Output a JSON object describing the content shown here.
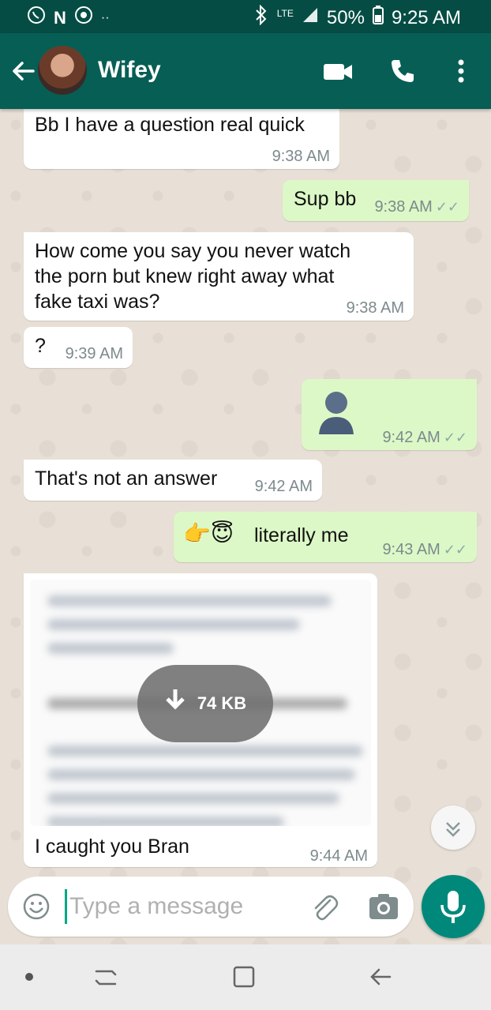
{
  "status_bar": {
    "lte": "LTE",
    "battery": "50%",
    "time": "9:25 AM"
  },
  "header": {
    "contact_name": "Wifey"
  },
  "messages": [
    {
      "text": "Bb I have a question real quick",
      "time": "9:38 AM"
    },
    {
      "text": "Sup bb",
      "time": "9:38 AM"
    },
    {
      "line1": "How come you say you never watch",
      "line2": "the porn but knew right away what",
      "line3": "fake taxi was?",
      "time": "9:38 AM"
    },
    {
      "text": "?",
      "time": "9:39 AM"
    },
    {
      "time": "9:42 AM"
    },
    {
      "text": "That's not an answer",
      "time": "9:42 AM"
    },
    {
      "emoji": "👉😇",
      "text": "literally me",
      "time": "9:43 AM"
    },
    {
      "download_size": "74 KB",
      "caption": "I caught you Bran",
      "time": "9:44 AM"
    }
  ],
  "input": {
    "placeholder": "Type a message"
  },
  "colors": {
    "header": "#075e54",
    "status_bar": "#054d44",
    "outgoing_bubble": "#dcf8c6",
    "incoming_bubble": "#ffffff",
    "mic_button": "#00897b"
  }
}
